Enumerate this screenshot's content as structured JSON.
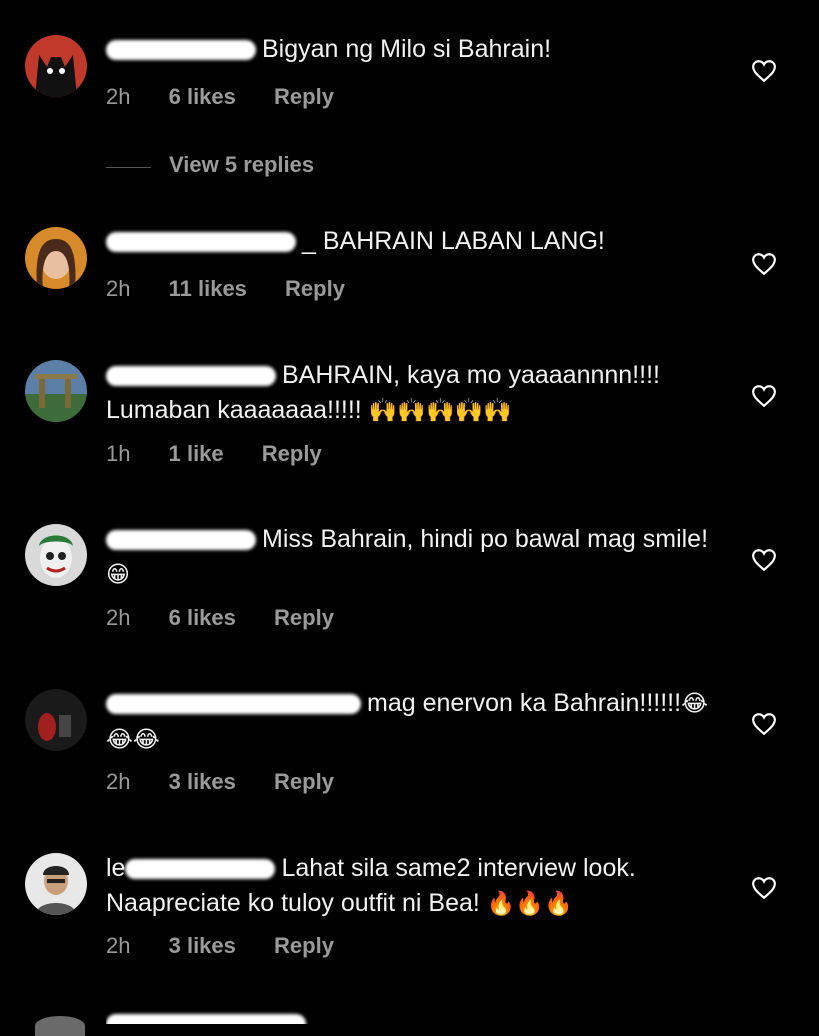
{
  "view_replies_label": "View 5 replies",
  "comments": [
    {
      "text": "Bigyan ng Milo si Bahrain!",
      "time": "2h",
      "likes": "6 likes",
      "reply": "Reply"
    },
    {
      "text": "_ BAHRAIN LABAN LANG!",
      "time": "2h",
      "likes": "11 likes",
      "reply": "Reply"
    },
    {
      "text": "BAHRAIN, kaya mo yaaaannnn!!!! Lumaban kaaaaaaa!!!!!",
      "emoji": "🙌🙌🙌🙌🙌",
      "time": "1h",
      "likes": "1 like",
      "reply": "Reply"
    },
    {
      "text": "Miss Bahrain, hindi po bawal mag smile!",
      "emoji": "😁",
      "time": "2h",
      "likes": "6 likes",
      "reply": "Reply"
    },
    {
      "text": "mag enervon ka Bahrain!!!!!!",
      "emoji": "😂😂😂",
      "time": "2h",
      "likes": "3 likes",
      "reply": "Reply"
    },
    {
      "user_prefix": "le",
      "text": "Lahat sila same2 interview look. Naapreciate ko tuloy outfit ni Bea!",
      "emoji": "🔥🔥🔥",
      "time": "2h",
      "likes": "3 likes",
      "reply": "Reply"
    }
  ],
  "colors": {
    "background": "#000000",
    "text": "#f2f2f2",
    "meta": "#9a9a9a"
  }
}
